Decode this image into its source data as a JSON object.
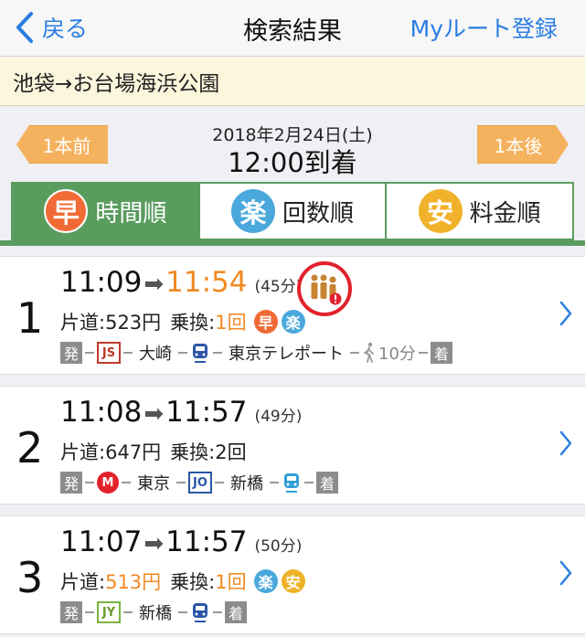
{
  "navbar": {
    "back_label": "戻る",
    "title": "検索結果",
    "right_label": "Myルート登録"
  },
  "route": {
    "text": "池袋→お台場海浜公園"
  },
  "date_nav": {
    "prev_label": "1本前",
    "next_label": "1本後",
    "date": "2018年2月24日(土)",
    "time": "12:00到着"
  },
  "sort_tabs": [
    {
      "badge": "早",
      "label": "時間順",
      "color": "#f06a35",
      "active": true
    },
    {
      "badge": "楽",
      "label": "回数順",
      "color": "#4aa8dc",
      "active": false
    },
    {
      "badge": "安",
      "label": "料金順",
      "color": "#f0b22a",
      "active": false
    }
  ],
  "results": [
    {
      "num": "1",
      "depart": "11:09",
      "arrive": "11:54",
      "duration": "(45分)",
      "fare_label": "片道:",
      "fare": "523円",
      "transfer_label": "乗換:",
      "transfers": "1回",
      "badges": [
        "早",
        "楽"
      ],
      "path": {
        "start": "発",
        "line1": "JS",
        "station1": "大崎",
        "station2": "東京テレポート",
        "walk": "10分",
        "end": "着"
      }
    },
    {
      "num": "2",
      "depart": "11:08",
      "arrive": "11:57",
      "duration": "(49分)",
      "fare_label": "片道:",
      "fare": "647円",
      "transfer_label": "乗換:",
      "transfers": "2回",
      "path": {
        "start": "発",
        "line1": "M",
        "station1": "東京",
        "line2": "JO",
        "station2": "新橋",
        "end": "着"
      }
    },
    {
      "num": "3",
      "depart": "11:07",
      "arrive": "11:57",
      "duration": "(50分)",
      "fare_label": "片道:",
      "fare": "513円",
      "transfer_label": "乗換:",
      "transfers": "1回",
      "badges": [
        "楽",
        "安"
      ],
      "path": {
        "start": "発",
        "line1": "JY",
        "station1": "新橋",
        "end": "着"
      }
    }
  ],
  "colors": {
    "accent_blue": "#2a7de1",
    "sort_green": "#5a9c5e",
    "orange": "#f08a24",
    "crowd_red": "#e3212d"
  },
  "icons": {
    "crowd": "crowd-warning-icon",
    "train": "train-icon",
    "walk": "walk-icon",
    "chevron": "chevron-right-icon"
  }
}
